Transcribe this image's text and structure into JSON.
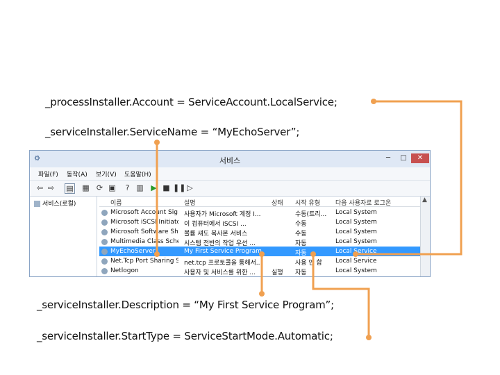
{
  "code_lines": {
    "account": "_processInstaller.Account = ServiceAccount.LocalService;",
    "service_name": "_serviceInstaller.ServiceName = “MyEchoServer”;",
    "description": "_serviceInstaller.Description = “My First Service Program”;",
    "start_type": "_serviceInstaller.StartType = ServiceStartMode.Automatic;"
  },
  "window": {
    "title": "서비스",
    "min_label": "─",
    "max_label": "□",
    "close_label": "✕",
    "menu": [
      "파일(F)",
      "동작(A)",
      "보기(V)",
      "도움말(H)"
    ],
    "tree_label": "서비스(로컬)",
    "columns": {
      "name": "이름",
      "description": "설명",
      "status": "상태",
      "startup": "시작 유형",
      "logon": "다음 사용자로 로그온"
    },
    "rows": [
      {
        "name": "Microsoft Account Sig...",
        "desc": "사용자가 Microsoft 계정 I...",
        "status": "",
        "startup": "수동(트리...",
        "logon": "Local System"
      },
      {
        "name": "Microsoft iSCSI Initiato...",
        "desc": "이 컴퓨터에서 iSCSI ...",
        "status": "",
        "startup": "수동",
        "logon": "Local System"
      },
      {
        "name": "Microsoft Software Sh...",
        "desc": "볼륨 섀도 복사본 서비스",
        "status": "",
        "startup": "수동",
        "logon": "Local System"
      },
      {
        "name": "Multimedia Class Sche...",
        "desc": "시스템 전반의 작업 우선 ...",
        "status": "",
        "startup": "자동",
        "logon": "Local System"
      },
      {
        "name": "MyEchoServer",
        "desc": "My First Service Program",
        "status": "",
        "startup": "자동",
        "logon": "Local Service",
        "selected": true
      },
      {
        "name": "Net.Tcp Port Sharing S...",
        "desc": "net.tcp 프로토콜을 통해서...",
        "status": "",
        "startup": "사용 안 함",
        "logon": "Local Service"
      },
      {
        "name": "Netlogon",
        "desc": "사용자 및 서비스를 위한 ...",
        "status": "실행",
        "startup": "자동",
        "logon": "Local System"
      }
    ]
  },
  "colors": {
    "connector": "#f0a050",
    "selection": "#3399ff"
  }
}
